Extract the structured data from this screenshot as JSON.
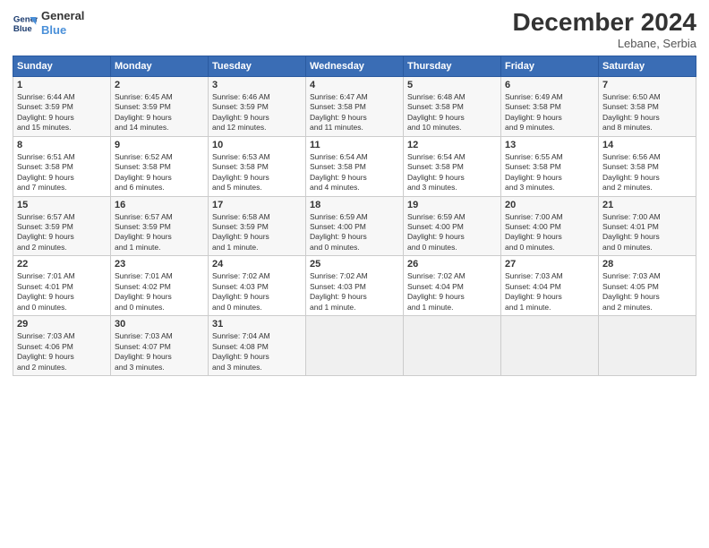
{
  "header": {
    "logo_line1": "General",
    "logo_line2": "Blue",
    "title": "December 2024",
    "subtitle": "Lebane, Serbia"
  },
  "columns": [
    "Sunday",
    "Monday",
    "Tuesday",
    "Wednesday",
    "Thursday",
    "Friday",
    "Saturday"
  ],
  "rows": [
    [
      {
        "day": "1",
        "info": "Sunrise: 6:44 AM\nSunset: 3:59 PM\nDaylight: 9 hours\nand 15 minutes."
      },
      {
        "day": "2",
        "info": "Sunrise: 6:45 AM\nSunset: 3:59 PM\nDaylight: 9 hours\nand 14 minutes."
      },
      {
        "day": "3",
        "info": "Sunrise: 6:46 AM\nSunset: 3:59 PM\nDaylight: 9 hours\nand 12 minutes."
      },
      {
        "day": "4",
        "info": "Sunrise: 6:47 AM\nSunset: 3:58 PM\nDaylight: 9 hours\nand 11 minutes."
      },
      {
        "day": "5",
        "info": "Sunrise: 6:48 AM\nSunset: 3:58 PM\nDaylight: 9 hours\nand 10 minutes."
      },
      {
        "day": "6",
        "info": "Sunrise: 6:49 AM\nSunset: 3:58 PM\nDaylight: 9 hours\nand 9 minutes."
      },
      {
        "day": "7",
        "info": "Sunrise: 6:50 AM\nSunset: 3:58 PM\nDaylight: 9 hours\nand 8 minutes."
      }
    ],
    [
      {
        "day": "8",
        "info": "Sunrise: 6:51 AM\nSunset: 3:58 PM\nDaylight: 9 hours\nand 7 minutes."
      },
      {
        "day": "9",
        "info": "Sunrise: 6:52 AM\nSunset: 3:58 PM\nDaylight: 9 hours\nand 6 minutes."
      },
      {
        "day": "10",
        "info": "Sunrise: 6:53 AM\nSunset: 3:58 PM\nDaylight: 9 hours\nand 5 minutes."
      },
      {
        "day": "11",
        "info": "Sunrise: 6:54 AM\nSunset: 3:58 PM\nDaylight: 9 hours\nand 4 minutes."
      },
      {
        "day": "12",
        "info": "Sunrise: 6:54 AM\nSunset: 3:58 PM\nDaylight: 9 hours\nand 3 minutes."
      },
      {
        "day": "13",
        "info": "Sunrise: 6:55 AM\nSunset: 3:58 PM\nDaylight: 9 hours\nand 3 minutes."
      },
      {
        "day": "14",
        "info": "Sunrise: 6:56 AM\nSunset: 3:58 PM\nDaylight: 9 hours\nand 2 minutes."
      }
    ],
    [
      {
        "day": "15",
        "info": "Sunrise: 6:57 AM\nSunset: 3:59 PM\nDaylight: 9 hours\nand 2 minutes."
      },
      {
        "day": "16",
        "info": "Sunrise: 6:57 AM\nSunset: 3:59 PM\nDaylight: 9 hours\nand 1 minute."
      },
      {
        "day": "17",
        "info": "Sunrise: 6:58 AM\nSunset: 3:59 PM\nDaylight: 9 hours\nand 1 minute."
      },
      {
        "day": "18",
        "info": "Sunrise: 6:59 AM\nSunset: 4:00 PM\nDaylight: 9 hours\nand 0 minutes."
      },
      {
        "day": "19",
        "info": "Sunrise: 6:59 AM\nSunset: 4:00 PM\nDaylight: 9 hours\nand 0 minutes."
      },
      {
        "day": "20",
        "info": "Sunrise: 7:00 AM\nSunset: 4:00 PM\nDaylight: 9 hours\nand 0 minutes."
      },
      {
        "day": "21",
        "info": "Sunrise: 7:00 AM\nSunset: 4:01 PM\nDaylight: 9 hours\nand 0 minutes."
      }
    ],
    [
      {
        "day": "22",
        "info": "Sunrise: 7:01 AM\nSunset: 4:01 PM\nDaylight: 9 hours\nand 0 minutes."
      },
      {
        "day": "23",
        "info": "Sunrise: 7:01 AM\nSunset: 4:02 PM\nDaylight: 9 hours\nand 0 minutes."
      },
      {
        "day": "24",
        "info": "Sunrise: 7:02 AM\nSunset: 4:03 PM\nDaylight: 9 hours\nand 0 minutes."
      },
      {
        "day": "25",
        "info": "Sunrise: 7:02 AM\nSunset: 4:03 PM\nDaylight: 9 hours\nand 1 minute."
      },
      {
        "day": "26",
        "info": "Sunrise: 7:02 AM\nSunset: 4:04 PM\nDaylight: 9 hours\nand 1 minute."
      },
      {
        "day": "27",
        "info": "Sunrise: 7:03 AM\nSunset: 4:04 PM\nDaylight: 9 hours\nand 1 minute."
      },
      {
        "day": "28",
        "info": "Sunrise: 7:03 AM\nSunset: 4:05 PM\nDaylight: 9 hours\nand 2 minutes."
      }
    ],
    [
      {
        "day": "29",
        "info": "Sunrise: 7:03 AM\nSunset: 4:06 PM\nDaylight: 9 hours\nand 2 minutes."
      },
      {
        "day": "30",
        "info": "Sunrise: 7:03 AM\nSunset: 4:07 PM\nDaylight: 9 hours\nand 3 minutes."
      },
      {
        "day": "31",
        "info": "Sunrise: 7:04 AM\nSunset: 4:08 PM\nDaylight: 9 hours\nand 3 minutes."
      },
      null,
      null,
      null,
      null
    ]
  ]
}
